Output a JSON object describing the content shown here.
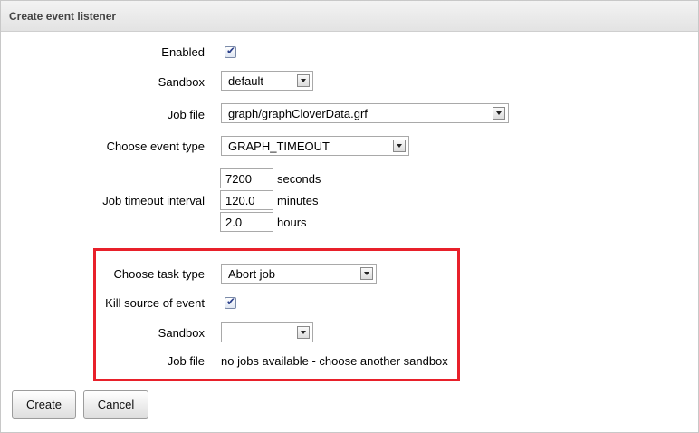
{
  "title": "Create event listener",
  "fields": {
    "enabled_label": "Enabled",
    "sandbox_label": "Sandbox",
    "sandbox_value": "default",
    "jobfile_label": "Job file",
    "jobfile_value": "graph/graphCloverData.grf",
    "eventtype_label": "Choose event type",
    "eventtype_value": "GRAPH_TIMEOUT",
    "timeout_label": "Job timeout interval",
    "timeout_seconds": "7200",
    "timeout_minutes": "120.0",
    "timeout_hours": "2.0",
    "unit_seconds": "seconds",
    "unit_minutes": "minutes",
    "unit_hours": "hours"
  },
  "task": {
    "tasktype_label": "Choose task type",
    "tasktype_value": "Abort job",
    "kill_label": "Kill source of event",
    "sandbox_label": "Sandbox",
    "sandbox_value": "",
    "jobfile_label": "Job file",
    "jobfile_message": "no jobs available - choose another sandbox"
  },
  "buttons": {
    "create": "Create",
    "cancel": "Cancel"
  },
  "colors": {
    "highlight": "#e8202a"
  }
}
